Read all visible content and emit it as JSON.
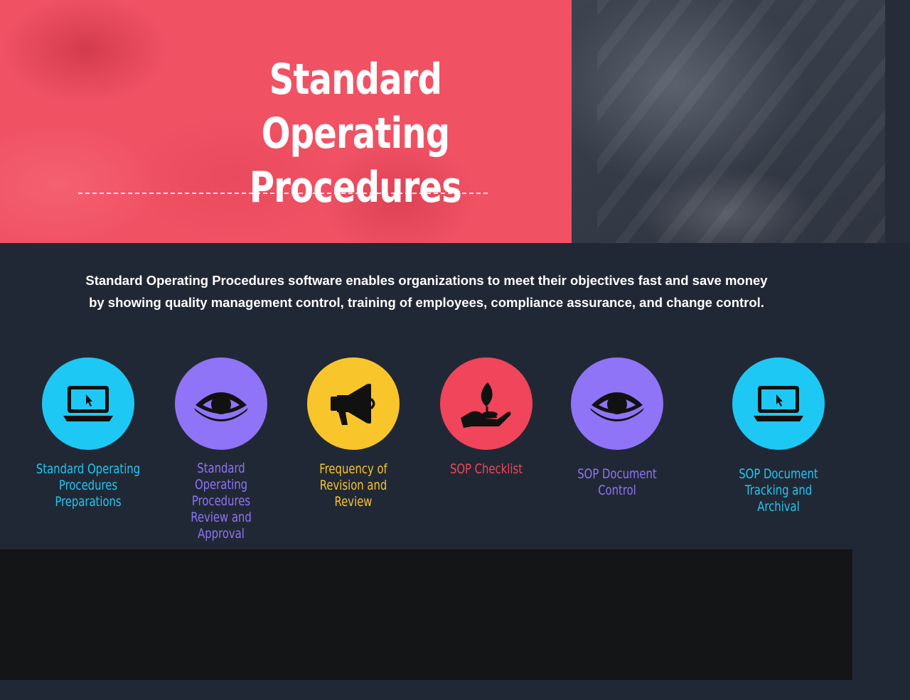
{
  "hero": {
    "title_line1": "Standard Operating",
    "title_line2": "Procedures"
  },
  "intro": {
    "line1": "Standard Operating Procedures software enables organizations to meet their objectives fast and save money",
    "line2": "by showing quality management control, training of employees, compliance assurance, and change control."
  },
  "features": [
    {
      "icon": "laptop-icon",
      "color": "#1ec8f4",
      "label_lines": [
        "Standard Operating",
        "Procedures",
        "Preparations"
      ]
    },
    {
      "icon": "eye-icon",
      "color": "#8f74f8",
      "label_lines": [
        "Standard",
        "Operating",
        "Procedures",
        "Review and",
        "Approval"
      ]
    },
    {
      "icon": "megaphone-icon",
      "color": "#f8c52b",
      "label_lines": [
        "Frequency of",
        "Revision and",
        "Review"
      ]
    },
    {
      "icon": "hand-plant-icon",
      "color": "#f0455a",
      "label_lines": [
        "SOP Checklist"
      ]
    },
    {
      "icon": "eye-icon",
      "color": "#8f74f8",
      "label_lines": [
        "SOP Document",
        "Control"
      ]
    },
    {
      "icon": "laptop-icon",
      "color": "#1ec8f4",
      "label_lines": [
        "SOP Document",
        "Tracking and Archival"
      ]
    }
  ],
  "colors": {
    "background": "#212835",
    "hero_panel": "#f05264",
    "dark_band": "#141516"
  }
}
